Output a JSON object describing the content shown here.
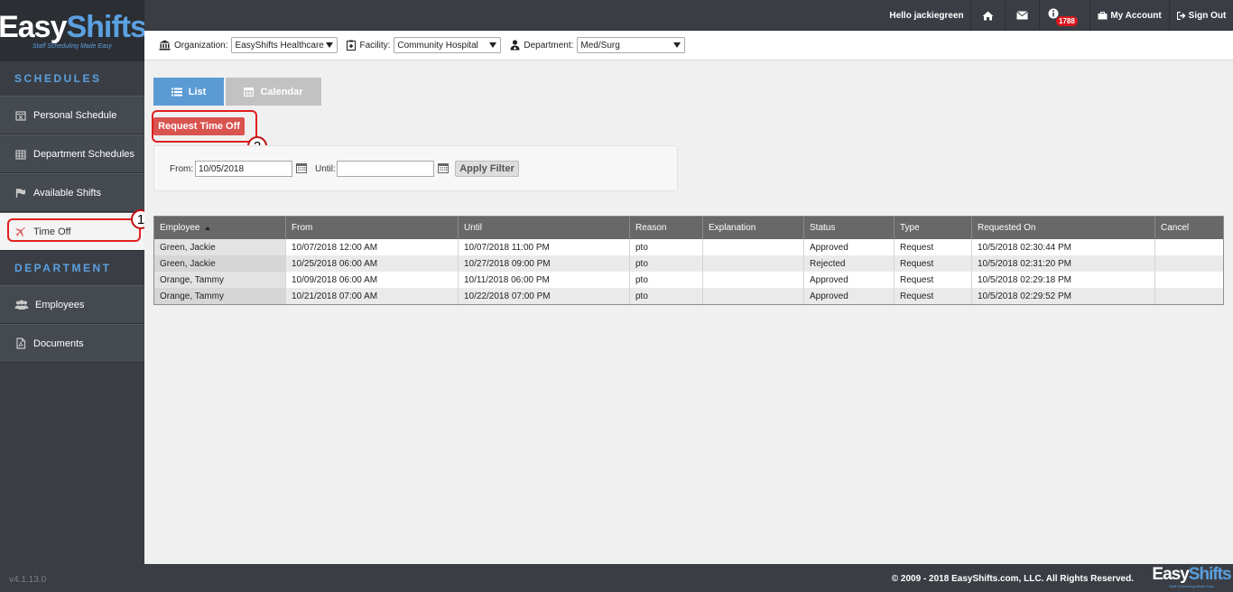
{
  "brand": {
    "logo_word_a": "Easy",
    "logo_word_b": "Shifts",
    "tagline": "Staff Scheduling Made Easy",
    "version": "v4.1.13.0",
    "accent": "#5ba0e0"
  },
  "sidebar": {
    "schedules_heading": "SCHEDULES",
    "schedules_items": [
      {
        "label": "Personal Schedule",
        "icon": "calendar-x-icon"
      },
      {
        "label": "Department Schedules",
        "icon": "calendar-grid-icon"
      },
      {
        "label": "Available Shifts",
        "icon": "flag-icon"
      },
      {
        "label": "Time Off",
        "icon": "plane-icon",
        "active": true
      }
    ],
    "department_heading": "DEPARTMENT",
    "department_items": [
      {
        "label": "Employees",
        "icon": "users-icon"
      },
      {
        "label": "Documents",
        "icon": "document-icon"
      }
    ]
  },
  "topbar": {
    "greeting": "Hello jackiegreen",
    "notification_count": "1788",
    "my_account": "My Account",
    "sign_out": "Sign Out"
  },
  "filterbar": {
    "organization_label": "Organization:",
    "organization_value": "EasyShifts Healthcare",
    "facility_label": "Facility:",
    "facility_value": "Community Hospital",
    "department_label": "Department:",
    "department_value": "Med/Surg"
  },
  "main": {
    "tab_list": "List",
    "tab_calendar": "Calendar",
    "request_button": "Request Time Off",
    "from_label": "From:",
    "from_value": "10/05/2018",
    "until_label": "Until:",
    "until_value": "",
    "apply_button": "Apply Filter",
    "annotations": [
      "1",
      "2"
    ]
  },
  "table": {
    "columns": [
      "Employee",
      "From",
      "Until",
      "Reason",
      "Explanation",
      "Status",
      "Type",
      "Requested On",
      "Cancel"
    ],
    "rows": [
      [
        "Green, Jackie",
        "10/07/2018 12:00 AM",
        "10/07/2018 11:00 PM",
        "pto",
        "",
        "Approved",
        "Request",
        "10/5/2018 02:30:44 PM",
        ""
      ],
      [
        "Green, Jackie",
        "10/25/2018 06:00 AM",
        "10/27/2018 09:00 PM",
        "pto",
        "",
        "Rejected",
        "Request",
        "10/5/2018 02:31:20 PM",
        ""
      ],
      [
        "Orange, Tammy",
        "10/09/2018 06:00 AM",
        "10/11/2018 06:00 PM",
        "pto",
        "",
        "Approved",
        "Request",
        "10/5/2018 02:29:18 PM",
        ""
      ],
      [
        "Orange, Tammy",
        "10/21/2018 07:00 AM",
        "10/22/2018 07:00 PM",
        "pto",
        "",
        "Approved",
        "Request",
        "10/5/2018 02:29:52 PM",
        ""
      ]
    ]
  },
  "footer": {
    "copyright": "© 2009 - 2018 EasyShifts.com, LLC. All Rights Reserved."
  }
}
